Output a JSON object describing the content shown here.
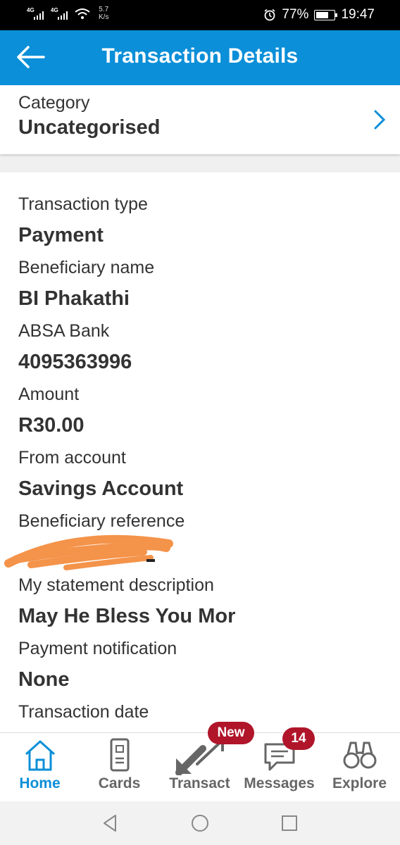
{
  "status_bar": {
    "signal1": "4G",
    "signal2": "4G",
    "speed_value": "5.7",
    "speed_unit": "K/s",
    "battery_percent": "77%",
    "battery_level": 0.77,
    "time": "19:47"
  },
  "app_bar": {
    "title": "Transaction Details",
    "back_icon": "arrow-left-icon"
  },
  "category": {
    "label": "Category",
    "value": "Uncategorised"
  },
  "details": {
    "fields": [
      {
        "label": "Transaction type",
        "value": "Payment"
      },
      {
        "label": "Beneficiary name",
        "value": "BI Phakathi"
      },
      {
        "label": "ABSA Bank",
        "value": "4095363996"
      },
      {
        "label": "Amount",
        "value": "R30.00"
      },
      {
        "label": "From account",
        "value": "Savings Account"
      },
      {
        "label": "Beneficiary reference",
        "value": ""
      },
      {
        "label": "My statement description",
        "value": "May He Bless You Mor"
      },
      {
        "label": "Payment notification",
        "value": "None"
      },
      {
        "label": "Transaction date",
        "value": ""
      }
    ],
    "redaction_color": "#f4934a"
  },
  "bottom_nav": {
    "items": [
      {
        "label": "Home",
        "icon": "home-icon",
        "active": true
      },
      {
        "label": "Cards",
        "icon": "card-icon",
        "active": false
      },
      {
        "label": "Transact",
        "icon": "transfer-arrows-icon",
        "active": false
      },
      {
        "label": "Messages",
        "icon": "chat-icon",
        "active": false
      },
      {
        "label": "Explore",
        "icon": "binoculars-icon",
        "active": false
      }
    ],
    "transact_badge": "New",
    "messages_badge": "14"
  },
  "colors": {
    "brand": "#0b8fd8",
    "badge": "#b0152a",
    "text": "#333333"
  }
}
